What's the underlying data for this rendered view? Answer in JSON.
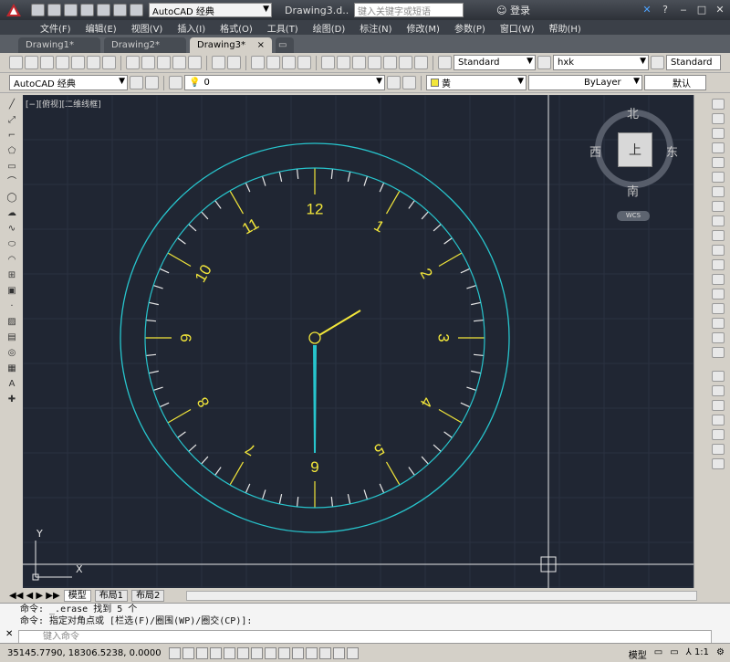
{
  "titlebar": {
    "workspace": "AutoCAD 经典",
    "title": "Drawing3.d...",
    "search_placeholder": "键入关键字或短语",
    "login": "登录"
  },
  "menu": [
    "文件(F)",
    "编辑(E)",
    "视图(V)",
    "插入(I)",
    "格式(O)",
    "工具(T)",
    "绘图(D)",
    "标注(N)",
    "修改(M)",
    "参数(P)",
    "窗口(W)",
    "帮助(H)"
  ],
  "tabs": [
    {
      "label": "Drawing1*",
      "active": false
    },
    {
      "label": "Drawing2*",
      "active": false
    },
    {
      "label": "Drawing3*",
      "active": true
    }
  ],
  "toolbar": {
    "text_style": "Standard",
    "dim_style": "hxk",
    "table_style": "Standard",
    "workspace2": "AutoCAD 经典",
    "layer": "0",
    "color": "黄",
    "linetype": "ByLayer",
    "lineweight": "默认"
  },
  "viewport": {
    "label": "[−][俯视][二维线框]",
    "colors": {
      "background": "#202633",
      "cyan": "#27c5cd",
      "yellow": "#f2e63a",
      "white": "#e8e8e8"
    }
  },
  "viewcube": {
    "north": "北",
    "south": "南",
    "east": "东",
    "west": "西",
    "face": "上",
    "ucs": "WCS"
  },
  "clock": {
    "numbers": [
      "12",
      "1",
      "2",
      "3",
      "4",
      "5",
      "6",
      "7",
      "8",
      "9",
      "10",
      "11"
    ]
  },
  "ucs_icon": {
    "x_label": "X",
    "y_label": "Y"
  },
  "layout_tabs": [
    "模型",
    "布局1",
    "布局2"
  ],
  "command": {
    "line1": "命令: _.erase 找到 5 个",
    "line2": "命令: 指定对角点或 [栏选(F)/圈围(WP)/圈交(CP)]:",
    "input_placeholder": "键入命令"
  },
  "status": {
    "coordinates": "35145.7790, 18306.5238, 0.0000",
    "model_label": "模型",
    "scale": "1:1"
  }
}
